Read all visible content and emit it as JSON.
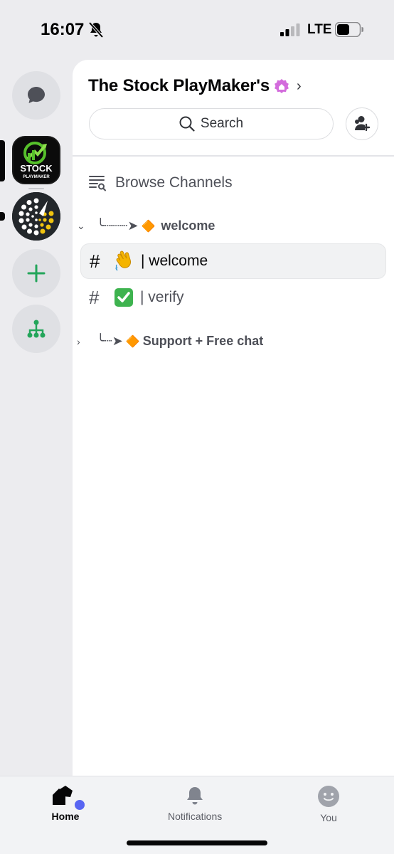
{
  "status_bar": {
    "time": "16:07",
    "network": "LTE"
  },
  "server": {
    "name": "The Stock PlayMaker's",
    "logo_text_top": "STOCK",
    "logo_text_bottom": "PLAYMAKER"
  },
  "search": {
    "label": "Search"
  },
  "browse_channels": {
    "label": "Browse Channels"
  },
  "categories": [
    {
      "prefix": "╰┈┈┈➤",
      "emoji": "🔶",
      "label": "welcome",
      "expanded": true
    },
    {
      "prefix": "╰┈➤",
      "emoji": "🔶",
      "label": "Support + Free chat",
      "expanded": false
    }
  ],
  "channels": [
    {
      "hash": "#",
      "emoji": "👋",
      "label": "| welcome",
      "selected": true
    },
    {
      "hash": "#",
      "emoji": "✅",
      "label": "| verify",
      "selected": false
    }
  ],
  "tabs": [
    {
      "label": "Home",
      "active": true
    },
    {
      "label": "Notifications",
      "active": false
    },
    {
      "label": "You",
      "active": false
    }
  ],
  "colors": {
    "accent_green": "#23a55a",
    "blurple": "#5865f2",
    "boost_pink": "#d36bdc"
  }
}
